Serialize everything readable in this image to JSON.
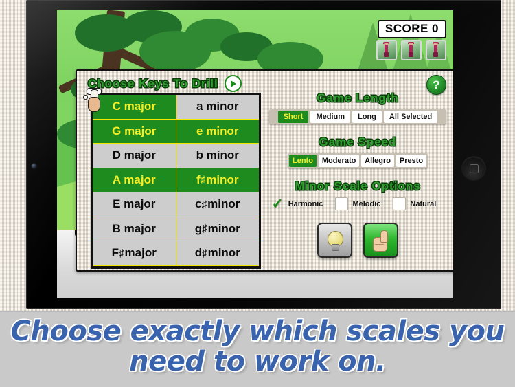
{
  "app": {
    "score_label": "SCORE 0",
    "lives_count": 3
  },
  "panel": {
    "title": "Choose Keys To Drill",
    "play_icon": "play-icon",
    "help_label": "?"
  },
  "keys_table": {
    "rows": [
      {
        "major": "C major",
        "major_on": true,
        "minor": "a minor",
        "minor_on": false
      },
      {
        "major": "G major",
        "major_on": true,
        "minor": "e minor",
        "minor_on": true
      },
      {
        "major": "D major",
        "major_on": false,
        "minor": "b minor",
        "minor_on": false
      },
      {
        "major": "A major",
        "major_on": true,
        "minor": "f# minor",
        "minor_on": true
      },
      {
        "major": "E major",
        "major_on": false,
        "minor": "c# minor",
        "minor_on": false
      },
      {
        "major": "B major",
        "major_on": false,
        "minor": "g# minor",
        "minor_on": false
      },
      {
        "major": "F# major",
        "major_on": false,
        "minor": "d# minor",
        "minor_on": false
      }
    ]
  },
  "game_length": {
    "heading": "Game Length",
    "options": [
      {
        "label": "Short",
        "selected": true
      },
      {
        "label": "Medium",
        "selected": false
      },
      {
        "label": "Long",
        "selected": false
      },
      {
        "label": "All Selected",
        "selected": false
      }
    ]
  },
  "game_speed": {
    "heading": "Game Speed",
    "options": [
      {
        "label": "Lento",
        "selected": true
      },
      {
        "label": "Moderato",
        "selected": false
      },
      {
        "label": "Allegro",
        "selected": false
      },
      {
        "label": "Presto",
        "selected": false
      }
    ]
  },
  "minor_scale_options": {
    "heading": "Minor Scale Options",
    "options": [
      {
        "label": "Harmonic",
        "checked": true
      },
      {
        "label": "Melodic",
        "checked": false
      },
      {
        "label": "Natural",
        "checked": false
      }
    ]
  },
  "actions": [
    {
      "name": "hint-button",
      "icon": "lightbulb-icon",
      "style": "grey"
    },
    {
      "name": "confirm-button",
      "icon": "thumbs-up-icon",
      "style": "green"
    }
  ],
  "caption": {
    "line1": "Choose exactly which scales you",
    "line2": "need to work on."
  },
  "colors": {
    "selected_green": "#1d8b1d",
    "selected_text": "#f7ef26",
    "panel_linen": "#ded6c7",
    "caption_blue": "#3a63ad",
    "grid_yellow": "#f2e800"
  }
}
